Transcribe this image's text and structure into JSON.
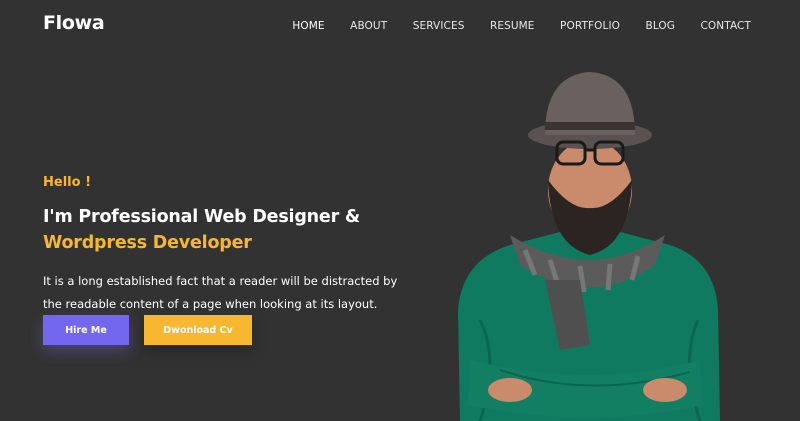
{
  "brand": {
    "logo": "Flowa"
  },
  "nav": {
    "items": [
      {
        "label": "HOME",
        "active": true
      },
      {
        "label": "ABOUT"
      },
      {
        "label": "SERVICES"
      },
      {
        "label": "RESUME"
      },
      {
        "label": "PORTFOLIO"
      },
      {
        "label": "BLOG"
      },
      {
        "label": "CONTACT"
      }
    ]
  },
  "hero": {
    "greeting": "Hello !",
    "headline_line1": "I'm Professional Web Designer &",
    "headline_line2": "Wordpress Developer",
    "description": "It is a long established fact that a reader will be distracted by the readable content of a page when looking at its layout.",
    "hire_button": "Hire Me",
    "cv_button": "Dwonload Cv"
  },
  "colors": {
    "background": "#333232",
    "accent_yellow": "#f7b731",
    "accent_purple": "#7367f0",
    "sweater_green": "#0f7a5f"
  },
  "icons": {
    "portrait": "man-with-hat-glasses-photo"
  }
}
